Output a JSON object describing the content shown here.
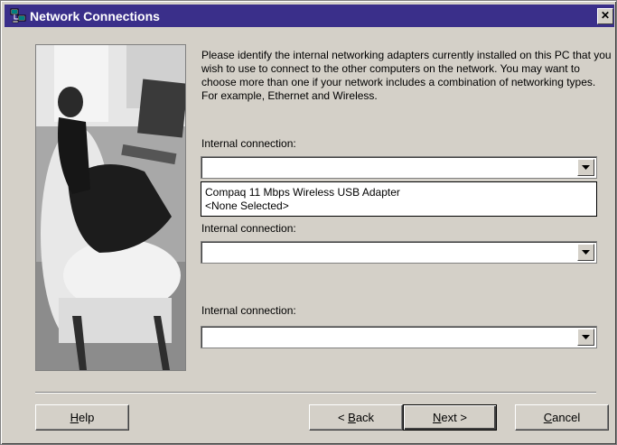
{
  "window": {
    "title": "Network Connections",
    "close_label": "✕"
  },
  "main": {
    "description": "Please identify the internal networking adapters currently installed on this PC that you wish to use to connect to the other computers on the network.  You may want to choose more than one if your network includes a combination of networking types.  For example, Ethernet and Wireless.",
    "connections": [
      {
        "label": "Internal connection:",
        "value": ""
      },
      {
        "label": "Internal connection:",
        "value": ""
      },
      {
        "label": "Internal connection:",
        "value": ""
      }
    ],
    "dropdown_options": [
      "Compaq 11 Mbps Wireless USB Adapter",
      "<None Selected>"
    ]
  },
  "buttons": {
    "help": {
      "access_key": "H",
      "rest": "elp"
    },
    "back": {
      "prefix": "< ",
      "access_key": "B",
      "rest": "ack"
    },
    "next": {
      "access_key": "N",
      "rest": "ext >"
    },
    "cancel": {
      "access_key": "C",
      "rest": "ancel"
    }
  }
}
